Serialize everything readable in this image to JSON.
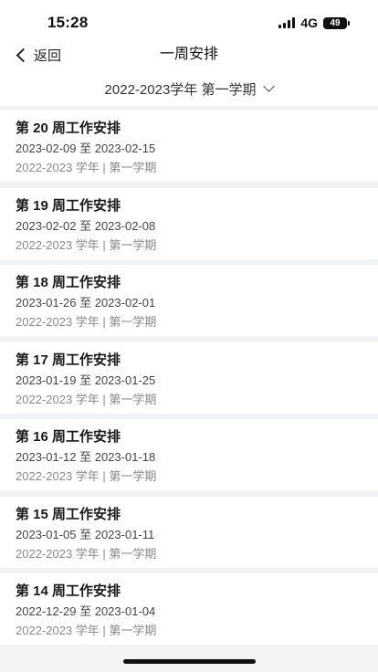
{
  "status_bar": {
    "time": "15:28",
    "network": "4G",
    "battery": "49"
  },
  "nav": {
    "back_label": "返回",
    "title": "一周安排"
  },
  "term_selector": {
    "label": "2022-2023学年 第一学期",
    "icon": "chevron-down-icon"
  },
  "weeks": [
    {
      "title": "第 20 周工作安排",
      "range": "2023-02-09 至 2023-02-15",
      "term": "2022-2023 学年 | 第一学期"
    },
    {
      "title": "第 19 周工作安排",
      "range": "2023-02-02 至 2023-02-08",
      "term": "2022-2023 学年 | 第一学期"
    },
    {
      "title": "第 18 周工作安排",
      "range": "2023-01-26 至 2023-02-01",
      "term": "2022-2023 学年 | 第一学期"
    },
    {
      "title": "第 17 周工作安排",
      "range": "2023-01-19 至 2023-01-25",
      "term": "2022-2023 学年 | 第一学期"
    },
    {
      "title": "第 16 周工作安排",
      "range": "2023-01-12 至 2023-01-18",
      "term": "2022-2023 学年 | 第一学期"
    },
    {
      "title": "第 15 周工作安排",
      "range": "2023-01-05 至 2023-01-11",
      "term": "2022-2023 学年 | 第一学期"
    },
    {
      "title": "第 14 周工作安排",
      "range": "2022-12-29 至 2023-01-04",
      "term": "2022-2023 学年 | 第一学期"
    }
  ]
}
